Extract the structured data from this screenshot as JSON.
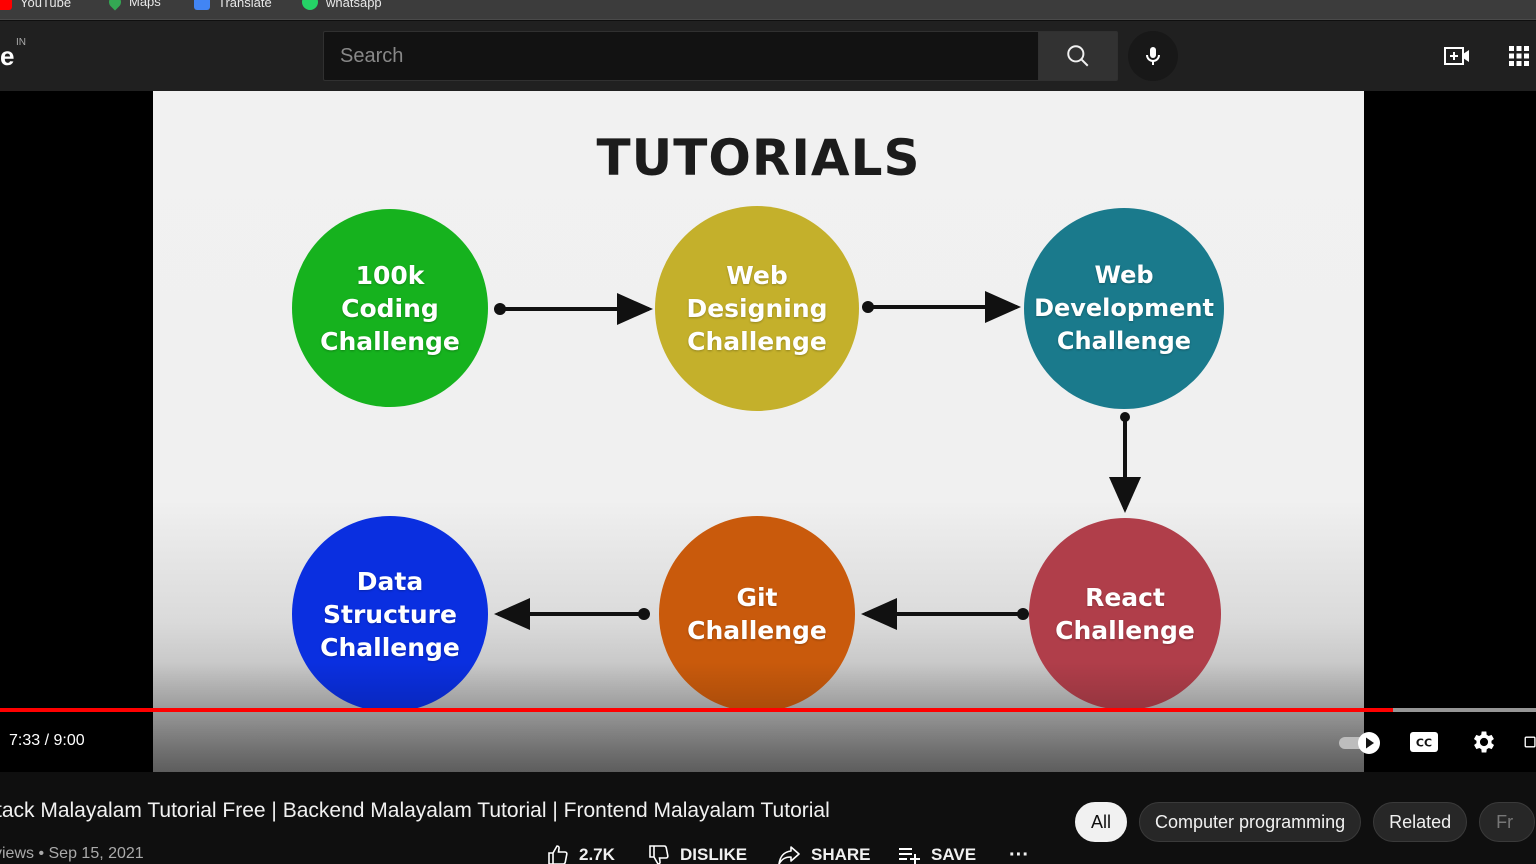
{
  "bookmarks": [
    {
      "label": "YouTube",
      "icon": "youtube-icon",
      "color": "#ff0000"
    },
    {
      "label": "Maps",
      "icon": "maps-icon",
      "color": "#34a853"
    },
    {
      "label": "Translate",
      "icon": "translate-icon",
      "color": "#4285f4"
    },
    {
      "label": "whatsapp",
      "icon": "whatsapp-icon",
      "color": "#25d366"
    }
  ],
  "header": {
    "logo_fragment": "e",
    "country_code": "IN",
    "search_placeholder": "Search",
    "search_icon": "search-icon",
    "mic_icon": "mic-icon",
    "create_icon": "video-create-icon",
    "apps_icon": "apps-grid-icon"
  },
  "video_frame": {
    "title": "TUTORIALS",
    "nodes": [
      {
        "label": "100k\nCoding\nChallenge",
        "color": "#16b21e"
      },
      {
        "label": "Web\nDesigning\nChallenge",
        "color": "#c4b02b"
      },
      {
        "label": "Web\nDevelopment\nChallenge",
        "color": "#1a7a8c"
      },
      {
        "label": "React\nChallenge",
        "color": "#b03e4a"
      },
      {
        "label": "Git\nChallenge",
        "color": "#c95a0c"
      },
      {
        "label": "Data\nStructure\nChallenge",
        "color": "#0a2fe0"
      }
    ]
  },
  "player": {
    "current_time": "7:33",
    "duration": "9:00",
    "time_text": "7:33 / 9:00",
    "played_fraction": 0.907,
    "loaded_fraction": 1.0,
    "progress_color": "#ff0000",
    "autoplay_icon": "autoplay-toggle-icon",
    "captions_icon": "cc-icon",
    "settings_icon": "gear-icon",
    "miniplayer_icon": "miniplayer-icon"
  },
  "video": {
    "title": "tack Malayalam Tutorial Free | Backend Malayalam Tutorial | Frontend Malayalam Tutorial",
    "meta": "views • Sep 15, 2021",
    "likes": "2.7K",
    "dislike_label": "DISLIKE",
    "share_label": "SHARE",
    "save_label": "SAVE",
    "more_label": "···"
  },
  "chips": [
    "All",
    "Computer programming",
    "Related",
    "Fr"
  ]
}
